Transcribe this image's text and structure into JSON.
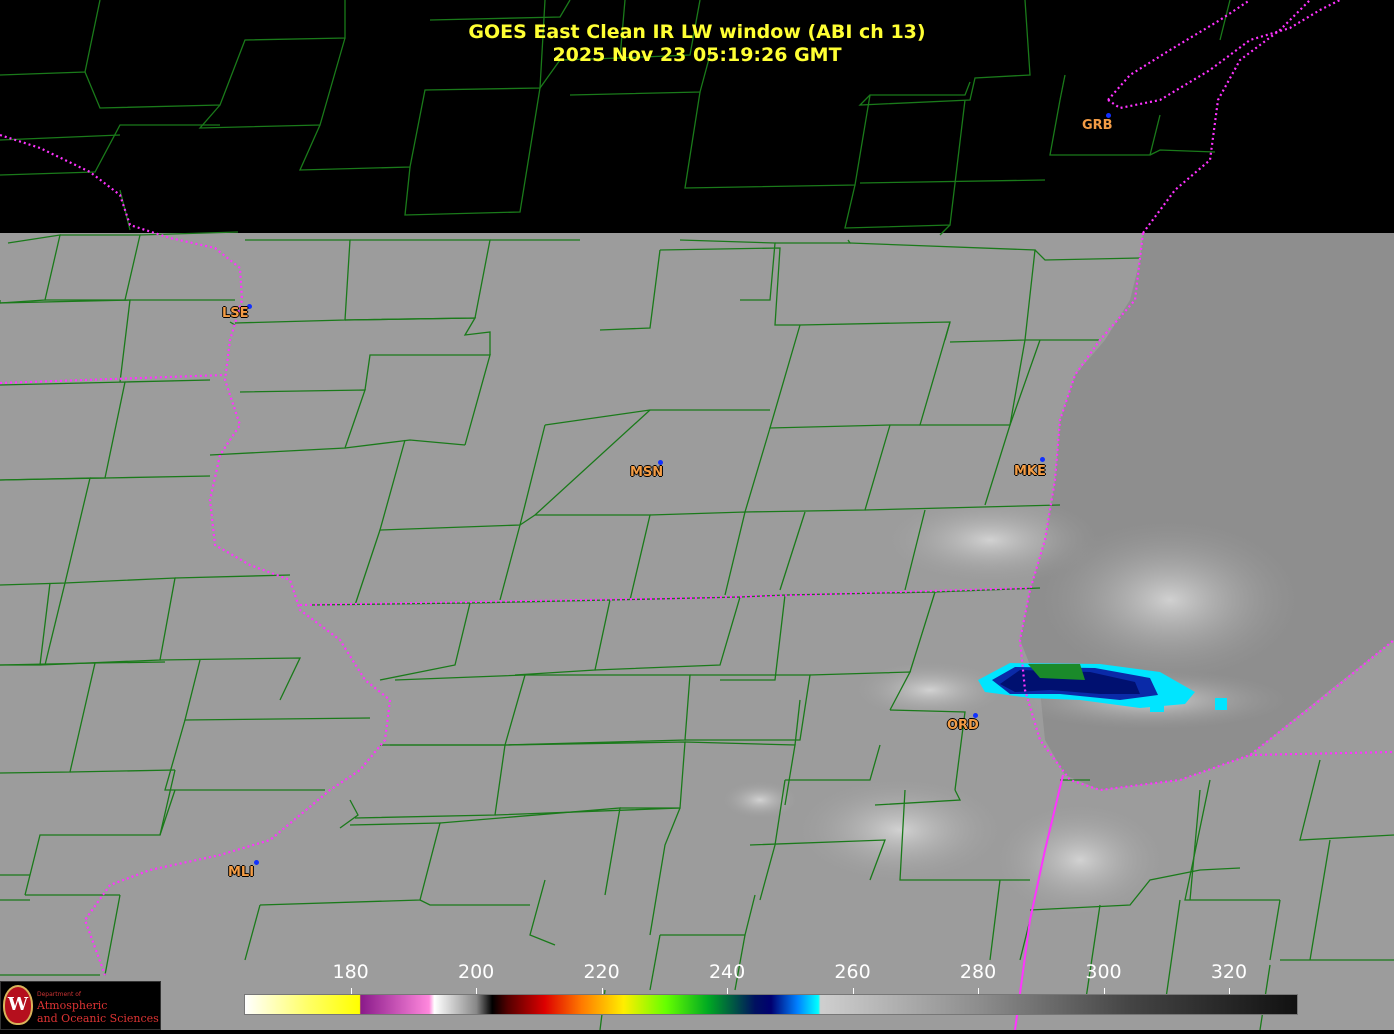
{
  "title": {
    "line1": "GOES East Clean IR LW window (ABI ch 13)",
    "line2": "2025 Nov 23  05:19:26 GMT"
  },
  "stations": [
    {
      "id": "GRB"
    },
    {
      "id": "LSE"
    },
    {
      "id": "MSN"
    },
    {
      "id": "MKE"
    },
    {
      "id": "ORD"
    },
    {
      "id": "MLI"
    }
  ],
  "colorbar": {
    "ticks": [
      "180",
      "200",
      "220",
      "240",
      "260",
      "280",
      "300",
      "320"
    ],
    "range": [
      163,
      331
    ]
  },
  "logo": {
    "letter": "W",
    "dept": "Department of",
    "line1": "Atmospheric",
    "line2": "and Oceanic Sciences"
  },
  "colors": {
    "title": "#ffff33",
    "county_lines": "#1a7a1a",
    "state_lines": "#ff33ff",
    "station_label": "#f39c45",
    "station_dot": "#1030ff"
  },
  "icons": [
    "uw-madison-seal-icon"
  ]
}
